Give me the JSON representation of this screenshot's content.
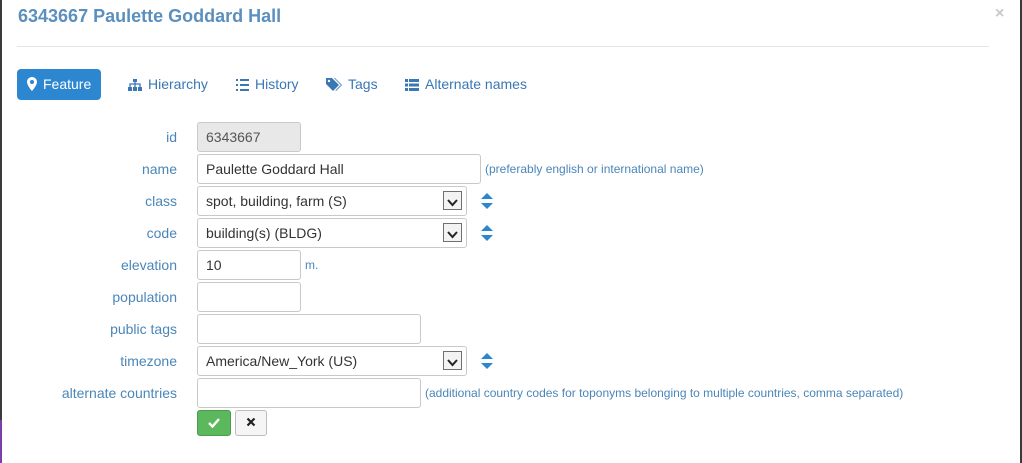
{
  "header": {
    "title": "6343667 Paulette Goddard Hall",
    "close_label": "×"
  },
  "tabs": [
    {
      "label": "Feature",
      "icon": "map-marker-icon",
      "active": true
    },
    {
      "label": "Hierarchy",
      "icon": "sitemap-icon",
      "active": false
    },
    {
      "label": "History",
      "icon": "list-icon",
      "active": false
    },
    {
      "label": "Tags",
      "icon": "tags-icon",
      "active": false
    },
    {
      "label": "Alternate names",
      "icon": "th-list-icon",
      "active": false
    }
  ],
  "form": {
    "id": {
      "label": "id",
      "value": "6343667"
    },
    "name": {
      "label": "name",
      "value": "Paulette Goddard Hall",
      "hint": "(preferably english or international name)"
    },
    "class": {
      "label": "class",
      "value": "spot, building, farm (S)"
    },
    "code": {
      "label": "code",
      "value": "building(s) (BLDG)"
    },
    "elevation": {
      "label": "elevation",
      "value": "10",
      "unit": "m."
    },
    "population": {
      "label": "population",
      "value": ""
    },
    "public_tags": {
      "label": "public tags",
      "value": ""
    },
    "timezone": {
      "label": "timezone",
      "value": "America/New_York (US)"
    },
    "alternate_countries": {
      "label": "alternate countries",
      "value": "",
      "hint": "(additional country codes for toponyms belonging to multiple countries, comma separated)"
    }
  },
  "colors": {
    "accent": "#2d86d0",
    "label": "#4a86b8",
    "save": "#5cb85c"
  }
}
